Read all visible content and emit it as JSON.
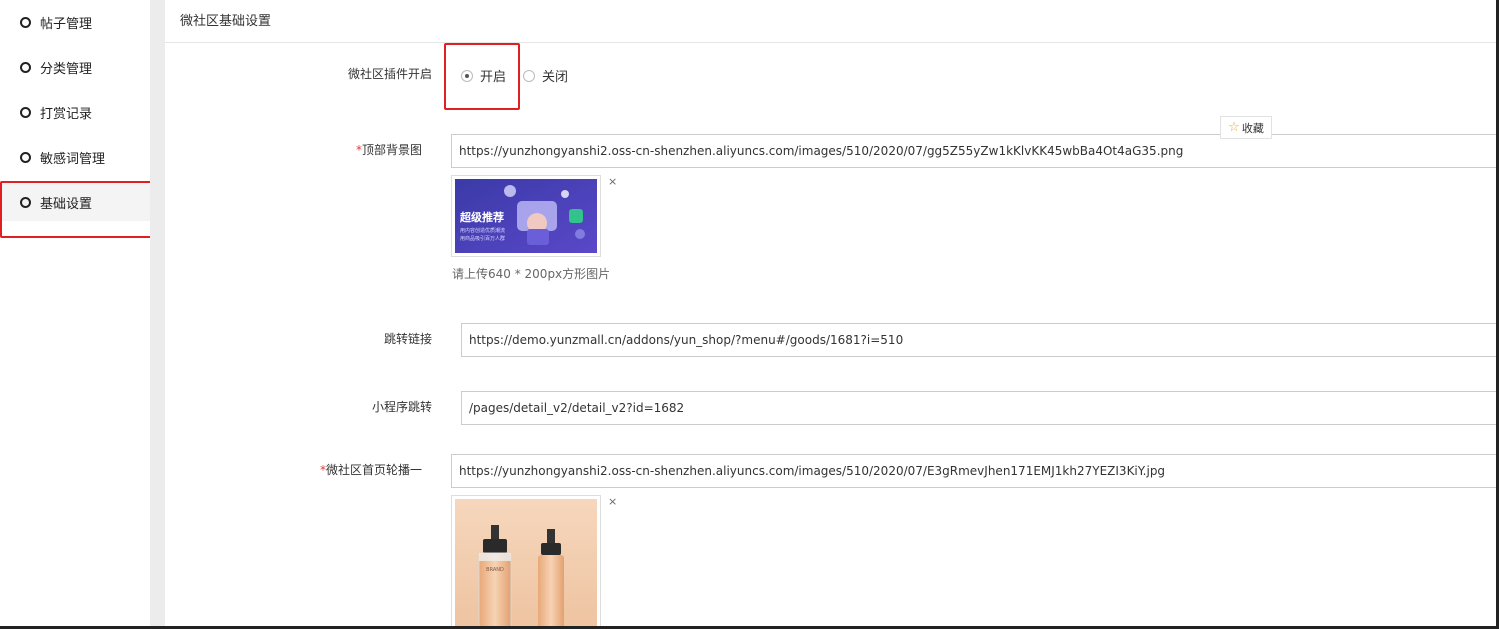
{
  "sidebar": {
    "items": [
      {
        "label": "帖子管理"
      },
      {
        "label": "分类管理"
      },
      {
        "label": "打赏记录"
      },
      {
        "label": "敏感词管理"
      },
      {
        "label": "基础设置"
      }
    ]
  },
  "panel": {
    "title": "微社区基础设置"
  },
  "fields": {
    "plugin_toggle": {
      "label": "微社区插件开启",
      "on_label": "开启",
      "off_label": "关闭",
      "selected": "开启"
    },
    "top_bg": {
      "required_mark": "*",
      "label": "顶部背景图",
      "value": "https://yunzhongyanshi2.oss-cn-shenzhen.aliyuncs.com/images/510/2020/07/gg5Z55yZw1kKlvKK45wbBa4Ot4aG35.png",
      "hint": "请上传640 * 200px方形图片",
      "preview": {
        "headline": "超级推荐",
        "line1": "用内容创造优质潮流",
        "line2": "用商品吸引百万人群"
      }
    },
    "jump_link": {
      "label": "跳转链接",
      "value": "https://demo.yunzmall.cn/addons/yun_shop/?menu#/goods/1681?i=510"
    },
    "mini_jump": {
      "label": "小程序跳转",
      "value": "/pages/detail_v2/detail_v2?id=1682"
    },
    "carousel1": {
      "required_mark": "*",
      "label": "微社区首页轮播一",
      "value": "https://yunzhongyanshi2.oss-cn-shenzhen.aliyuncs.com/images/510/2020/07/E3gRmevJhen171EMJ1kh27YEZI3KiY.jpg",
      "preview": {
        "brand": "BRAND"
      }
    }
  },
  "remove_symbol": "×",
  "favorite": {
    "label": "收藏",
    "icon": "star-icon"
  },
  "colors": {
    "highlight": "#e02020",
    "required": "#e4393c",
    "star": "#f5a623"
  }
}
